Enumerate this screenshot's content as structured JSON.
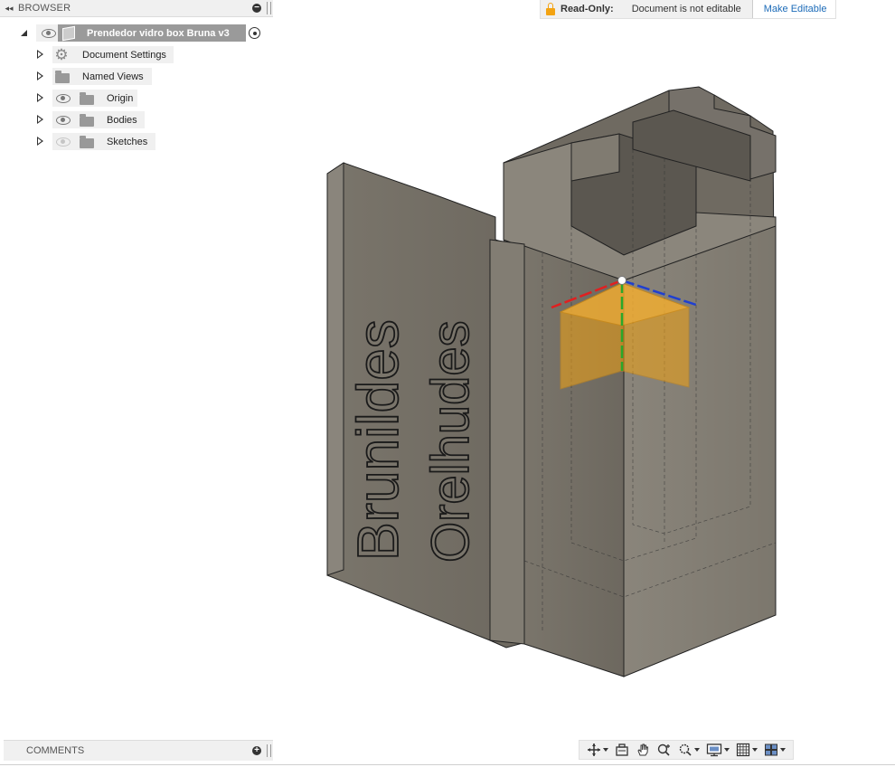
{
  "browser": {
    "title": "BROWSER",
    "root": {
      "label": "Prendedor vidro box Bruna v3"
    },
    "items": [
      {
        "label": "Document Settings",
        "icon": "gear-icon"
      },
      {
        "label": "Named Views",
        "icon": "folder-icon"
      },
      {
        "label": "Origin",
        "icon": "folder-icon",
        "visible": true
      },
      {
        "label": "Bodies",
        "icon": "folder-icon",
        "visible": true
      },
      {
        "label": "Sketches",
        "icon": "folder-icon",
        "visible": false
      }
    ]
  },
  "readonly": {
    "label": "Read-Only:",
    "message": "Document is not editable",
    "action": "Make Editable",
    "accent": "#f3a312",
    "link_color": "#1c6bb8"
  },
  "model": {
    "text_line_1": "Brunildes",
    "text_line_2": "Orelhudes",
    "body_color": "#7b766c"
  },
  "comments": {
    "title": "COMMENTS"
  },
  "navbar": {
    "tools": [
      "orbit-icon",
      "look-at-icon",
      "pan-icon",
      "zoom-icon",
      "fit-icon",
      "display-settings-icon",
      "grid-icon",
      "viewports-icon"
    ]
  }
}
